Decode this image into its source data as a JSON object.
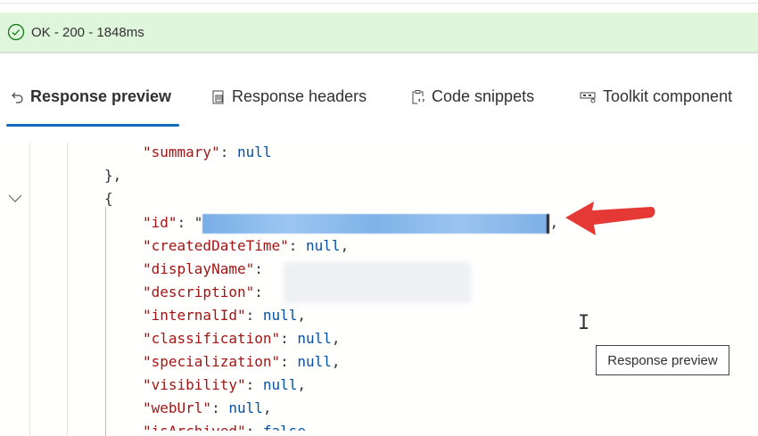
{
  "status": {
    "text": "OK - 200 - 1848ms",
    "icon": "check-circle-icon",
    "color": "#dff6dd"
  },
  "tabs": [
    {
      "label": "Response preview",
      "icon": "undo-arrow-icon",
      "active": true
    },
    {
      "label": "Response headers",
      "icon": "document-icon"
    },
    {
      "label": "Code snippets",
      "icon": "clipboard-code-icon"
    },
    {
      "label": "Toolkit component",
      "icon": "component-icon"
    }
  ],
  "code": {
    "summary_key": "\"summary\"",
    "summary_val": "null",
    "close_brace": "},",
    "open_brace": "{",
    "id_key": "\"id\"",
    "fields": [
      {
        "key": "\"createdDateTime\"",
        "val": "null"
      },
      {
        "key": "\"displayName\"",
        "val": ""
      },
      {
        "key": "\"description\"",
        "val": ""
      },
      {
        "key": "\"internalId\"",
        "val": "null"
      },
      {
        "key": "\"classification\"",
        "val": "null"
      },
      {
        "key": "\"specialization\"",
        "val": "null"
      },
      {
        "key": "\"visibility\"",
        "val": "null"
      },
      {
        "key": "\"webUrl\"",
        "val": "null"
      },
      {
        "key": "\"isArchived\"",
        "val": "false"
      }
    ]
  },
  "tooltip": "Response preview",
  "accent": "#0f6cbd"
}
